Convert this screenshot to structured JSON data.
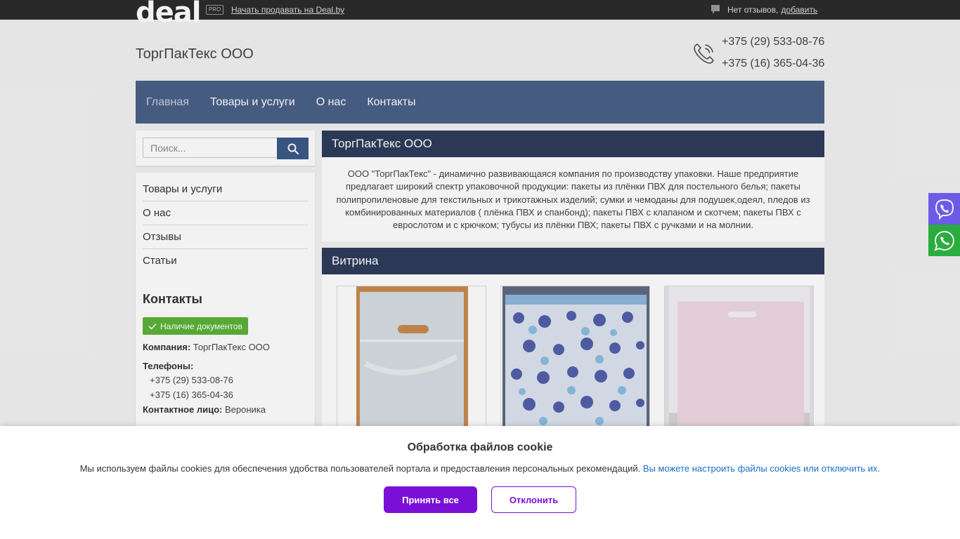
{
  "topbar": {
    "logo": "deal",
    "pro_badge": "PRO",
    "sell_link": "Начать продавать на Deal.by",
    "reviews_text": "Нет отзывов,",
    "reviews_add": "добавить"
  },
  "header": {
    "company_name": "ТоргПакТекс ООО",
    "phones": [
      "+375 (29) 533-08-76",
      "+375 (16) 365-04-36"
    ]
  },
  "nav": {
    "items": [
      {
        "label": "Главная",
        "active": true
      },
      {
        "label": "Товары и услуги"
      },
      {
        "label": "О нас"
      },
      {
        "label": "Контакты"
      }
    ]
  },
  "search": {
    "placeholder": "Поиск..."
  },
  "sidebar": {
    "menu": [
      "Товары и услуги",
      "О нас",
      "Отзывы",
      "Статьи"
    ],
    "contacts_title": "Контакты",
    "docs_badge": "Наличие документов",
    "company_label": "Компания:",
    "company_value": "ТоргПакТекс ООО",
    "phones_label": "Телефоны:",
    "phones": [
      "+375 (29) 533-08-76",
      "+375 (16) 365-04-36"
    ],
    "contact_label": "Контактное лицо:",
    "contact_value": "Вероника"
  },
  "main": {
    "title": "ТоргПакТекс ООО",
    "about": "ООО \"ТоргПакТекс\" - динамично развивающаяся компания по производству упаковки. Наше предприятие предлагает широкий спектр упаковочной продукции: пакеты из плёнки ПВХ для постельного белья; пакеты полипропиленовые для текстильных и трикотажных изделий; сумки и чемоданы для подушек,одеял, пледов из комбинированных материалов ( плёнка ПВХ и спанбонд); пакеты ПВХ с клапаном и скотчем; пакеты ПВХ с еврослотом и с крючком; тубусы из плёнки ПВХ; пакеты ПВХ с ручками и на молнии.",
    "showcase_title": "Витрина"
  },
  "cookie": {
    "title": "Обработка файлов cookie",
    "text": "Мы используем файлы cookies для обеспечения удобства пользователей портала и предоставления персональных рекомендаций.",
    "link": "Вы можете настроить файлы cookies или отключить их.",
    "accept": "Принять все",
    "decline": "Отклонить"
  },
  "colors": {
    "nav": "#4a6087",
    "section_header": "#2e3d5c",
    "accent_purple": "#7a10d8",
    "viber": "#7360f2",
    "whatsapp": "#2cb742",
    "badge_green": "#5cb338"
  }
}
